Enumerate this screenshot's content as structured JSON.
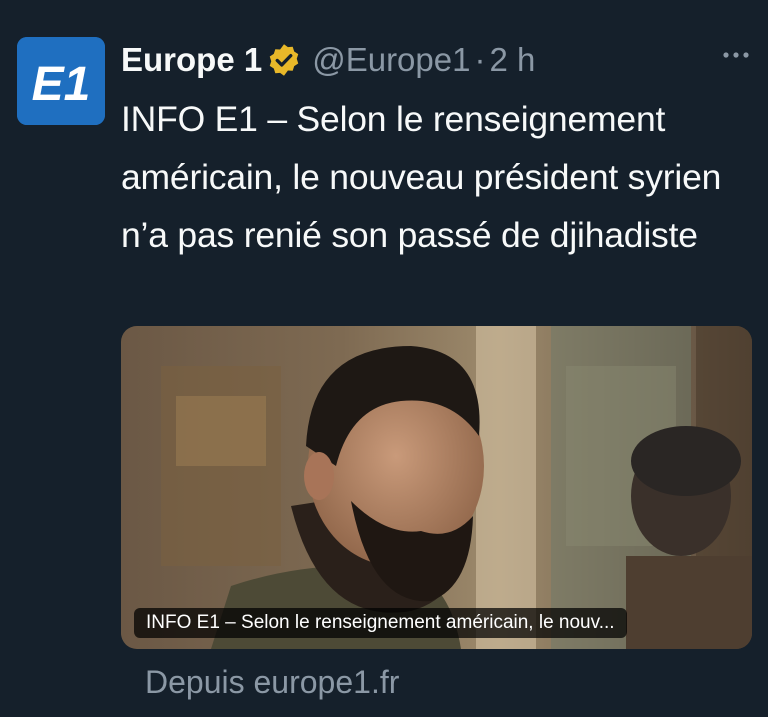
{
  "tweet": {
    "author": {
      "display_name": "Europe 1",
      "handle": "@Europe1",
      "verified": true,
      "avatar_text": "E1",
      "avatar_icon": "europe1-logo"
    },
    "separator": "·",
    "time": "2 h",
    "more_icon": "more-horizontal-icon",
    "text": "INFO E1 – Selon le renseignement américain, le nouveau président syrien n’a pas renié son passé de djihadiste",
    "card": {
      "caption": "INFO E1 – Selon le renseignement américain, le nouv...",
      "source": "Depuis europe1.fr"
    }
  },
  "colors": {
    "background": "#15202b",
    "text_primary": "#f7f9f9",
    "text_secondary": "#8b98a5",
    "brand_blue": "#1f6fc0",
    "verified_gold": "#e8b829"
  }
}
